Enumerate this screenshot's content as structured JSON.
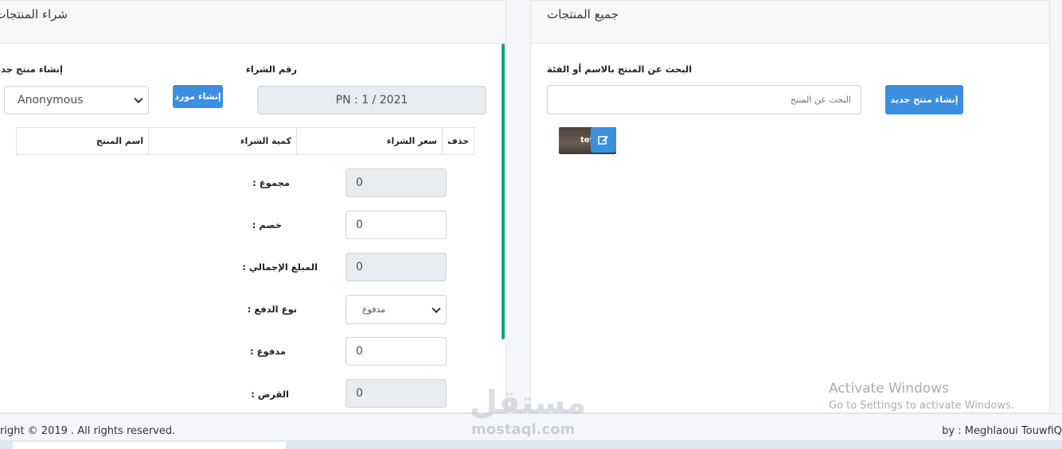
{
  "purchase_panel": {
    "title": "شراء المنتجات",
    "new_product_label": "إنشاء منتج جديد",
    "supplier_select_value": "Anonymous",
    "create_supplier_button": "إنشاء مورد",
    "purchase_number_label": "رقم الشراء",
    "purchase_number_value": "PN : 1 / 2021",
    "table_headers": {
      "product_name": "اسم المنتج",
      "purchase_quantity": "كمية الشراء",
      "purchase_price": "سعر الشراء",
      "delete": "حذف"
    },
    "fields": {
      "total_label": "مجموع :",
      "total_value": "0",
      "discount_label": "خصم :",
      "discount_value": "0",
      "grand_total_label": "المبلغ الإجمالي :",
      "grand_total_value": "0",
      "payment_type_label": "نوع الدفع :",
      "payment_type_value": "مدفوع",
      "paid_label": "مدفوع :",
      "paid_value": "0",
      "loan_label": "القرض :",
      "loan_value": "0"
    }
  },
  "products_panel": {
    "title": "جميع المنتجات",
    "search_label": "البحث عن المنتج بالاسم أو الفئة",
    "search_placeholder": "البحث عن المنتج",
    "create_product_button": "إنشاء منتج جديد",
    "product_tile_text": "tet",
    "edit_icon": "edit-icon"
  },
  "footer": {
    "copyright": "right © 2019 . All rights reserved.",
    "author": "by : Meghlaoui TouwfiQ"
  },
  "overlay": {
    "activate_title": "Activate Windows",
    "activate_subtitle": "Go to Settings to activate Windows.",
    "watermark_ar": "مستقل",
    "watermark_en": "mostaql.com"
  },
  "colors": {
    "primary": "#3b8ee0",
    "scroll_accent": "#17a07a"
  }
}
